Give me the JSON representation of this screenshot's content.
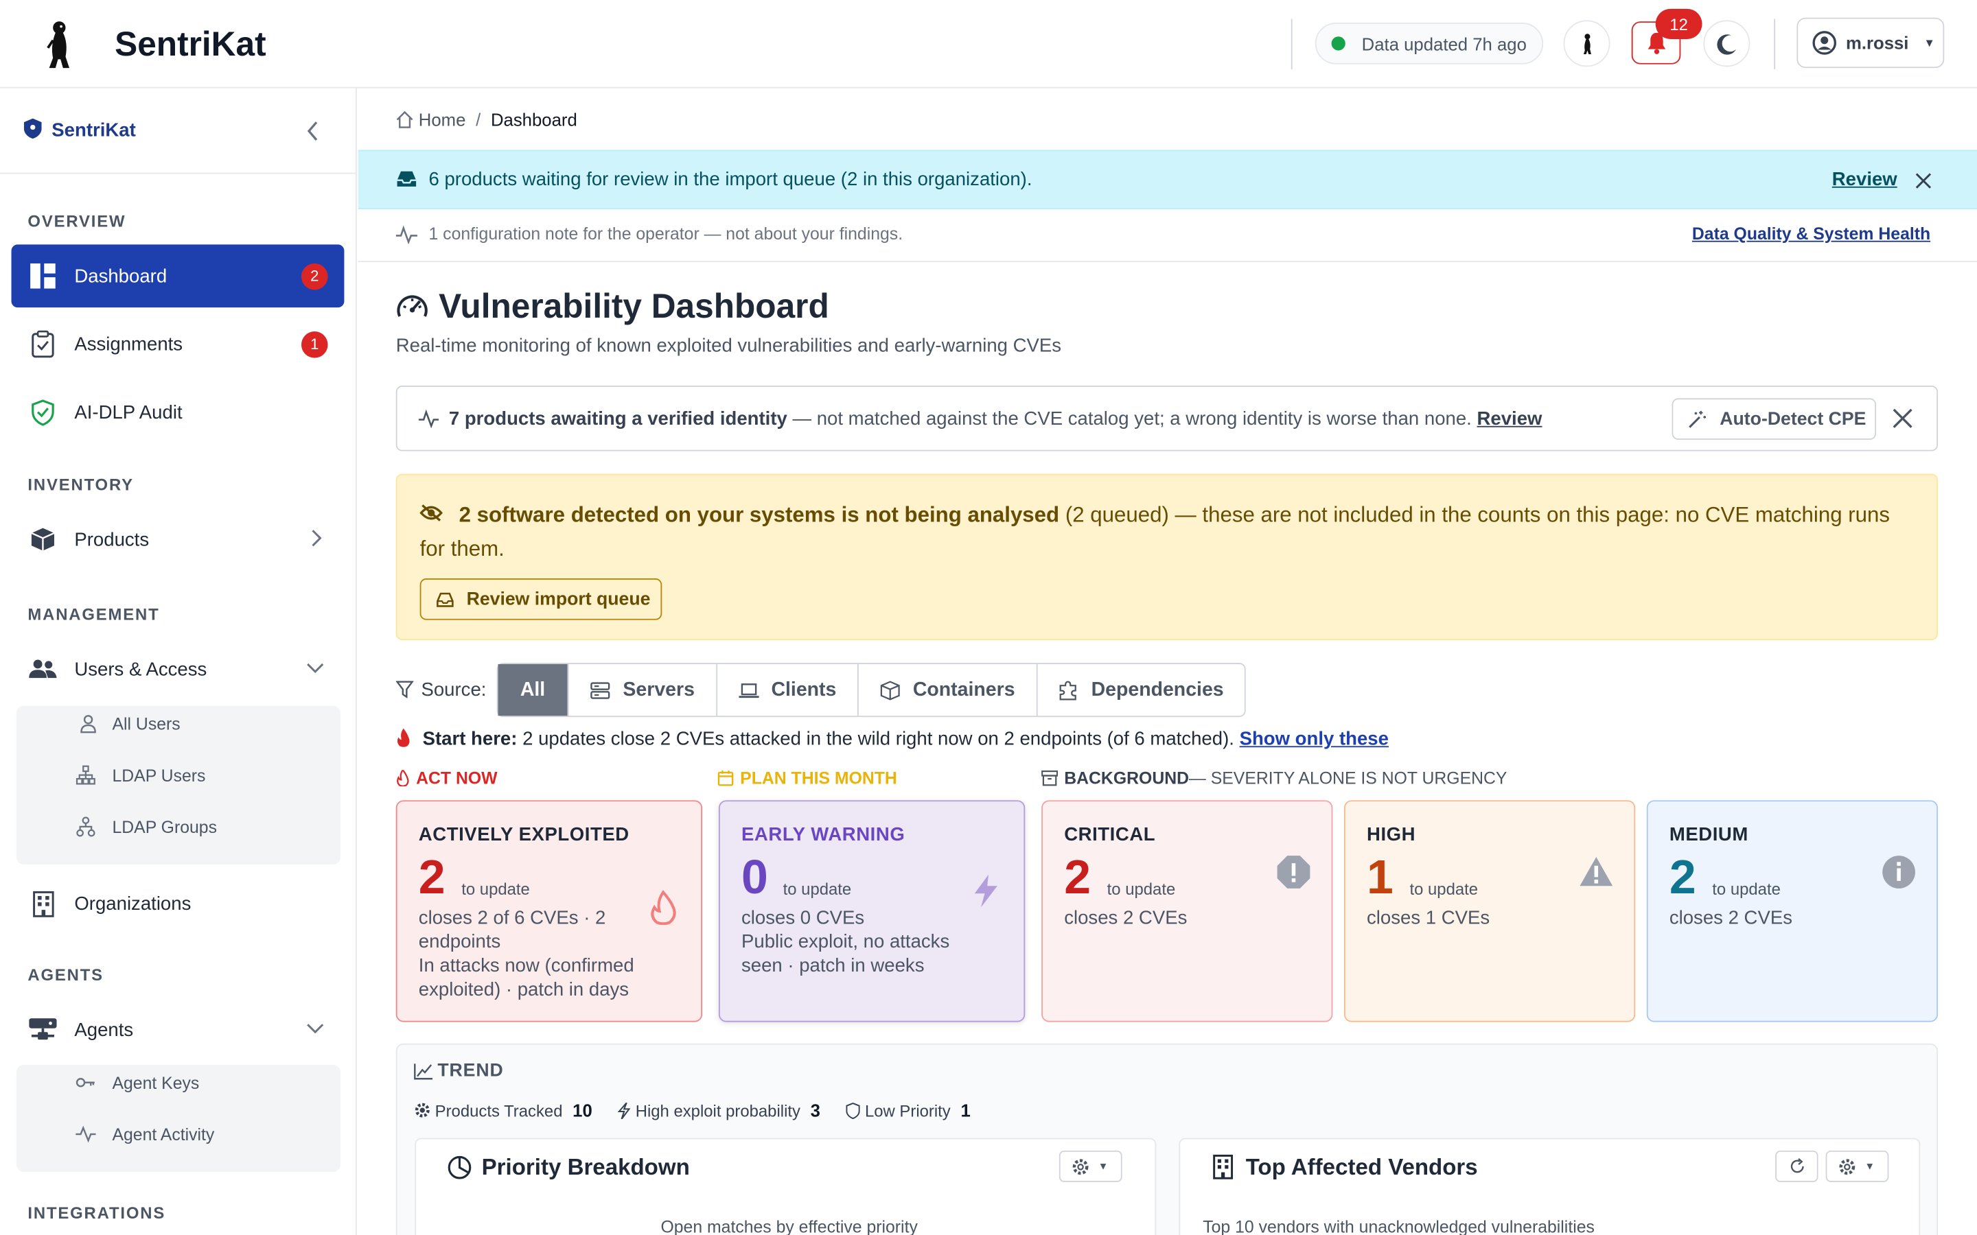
{
  "app": {
    "name": "SentriKat"
  },
  "header": {
    "status_text": "Data updated 7h ago",
    "notification_count": "12",
    "user": "m.rossi"
  },
  "sidebar": {
    "title": "SentriKat",
    "sections": {
      "overview": "OVERVIEW",
      "inventory": "INVENTORY",
      "management": "MANAGEMENT",
      "agents": "AGENTS",
      "integrations": "INTEGRATIONS"
    },
    "items": {
      "dashboard": {
        "label": "Dashboard",
        "badge": "2"
      },
      "assignments": {
        "label": "Assignments",
        "badge": "1"
      },
      "audit": {
        "label": "AI-DLP Audit"
      },
      "products": {
        "label": "Products"
      },
      "users_access": {
        "label": "Users & Access"
      },
      "all_users": {
        "label": "All Users"
      },
      "ldap_users": {
        "label": "LDAP Users"
      },
      "ldap_groups": {
        "label": "LDAP Groups"
      },
      "organizations": {
        "label": "Organizations"
      },
      "agents": {
        "label": "Agents"
      },
      "agent_keys": {
        "label": "Agent Keys"
      },
      "agent_activity": {
        "label": "Agent Activity"
      }
    }
  },
  "breadcrumb": {
    "home": "Home",
    "sep": "/",
    "current": "Dashboard"
  },
  "import_banner": {
    "text": "6 products waiting for review in the import queue (2 in this organization).",
    "action": "Review"
  },
  "config_note": {
    "text": "1 configuration note for the operator — not about your findings.",
    "link": "Data Quality & System Health"
  },
  "page": {
    "title": "Vulnerability Dashboard",
    "subtitle": "Real-time monitoring of known exploited vulnerabilities and early-warning CVEs"
  },
  "identity_notice": {
    "bold": "7 products awaiting a verified identity",
    "text": " — not matched against the CVE catalog yet; a wrong identity is worse than none. ",
    "link": "Review",
    "button": "Auto-Detect CPE"
  },
  "analysis_warning": {
    "bold": "2 software detected on your systems is not being analysed",
    "text": " (2 queued) — these are not included in the counts on this page: no CVE matching runs for them.",
    "button": "Review import queue"
  },
  "source_filter": {
    "label": "Source:",
    "options": [
      "All",
      "Servers",
      "Clients",
      "Containers",
      "Dependencies"
    ],
    "selected": "All"
  },
  "start_here": {
    "bold": "Start here:",
    "text": " 2 updates close 2 CVEs attacked in the wild right now on 2 endpoints (of 6 matched). ",
    "link": "Show only these"
  },
  "tiers": {
    "act": "ACT NOW",
    "plan": "PLAN THIS MONTH",
    "background": "BACKGROUND",
    "background_note": " — SEVERITY ALONE IS NOT URGENCY"
  },
  "cards": [
    {
      "title": "ACTIVELY EXPLOITED",
      "count": "2",
      "unit": "to update",
      "line1": "closes 2 of 6 CVEs · 2 endpoints",
      "line2": "In attacks now (confirmed exploited) · patch in days"
    },
    {
      "title": "EARLY WARNING",
      "count": "0",
      "unit": "to update",
      "line1": "closes 0 CVEs",
      "line2": "Public exploit, no attacks seen · patch in weeks"
    },
    {
      "title": "CRITICAL",
      "count": "2",
      "unit": "to update",
      "line1": "closes 2 CVEs"
    },
    {
      "title": "HIGH",
      "count": "1",
      "unit": "to update",
      "line1": "closes 1 CVEs"
    },
    {
      "title": "MEDIUM",
      "count": "2",
      "unit": "to update",
      "line1": "closes 2 CVEs"
    }
  ],
  "trend": {
    "title": "TREND",
    "stats": [
      {
        "label": "Products Tracked",
        "value": "10"
      },
      {
        "label": "High exploit probability",
        "value": "3"
      },
      {
        "label": "Low Priority",
        "value": "1"
      }
    ]
  },
  "panels": {
    "priority": {
      "title": "Priority Breakdown",
      "subtitle": "Open matches by effective priority"
    },
    "vendors": {
      "title": "Top Affected Vendors",
      "subtitle": "Top 10 vendors with unacknowledged vulnerabilities"
    }
  },
  "colors": {
    "primary": "#1e40af",
    "danger": "#dc2626",
    "warning_bg": "#fff3cd",
    "info_bg": "#cff4fc"
  }
}
